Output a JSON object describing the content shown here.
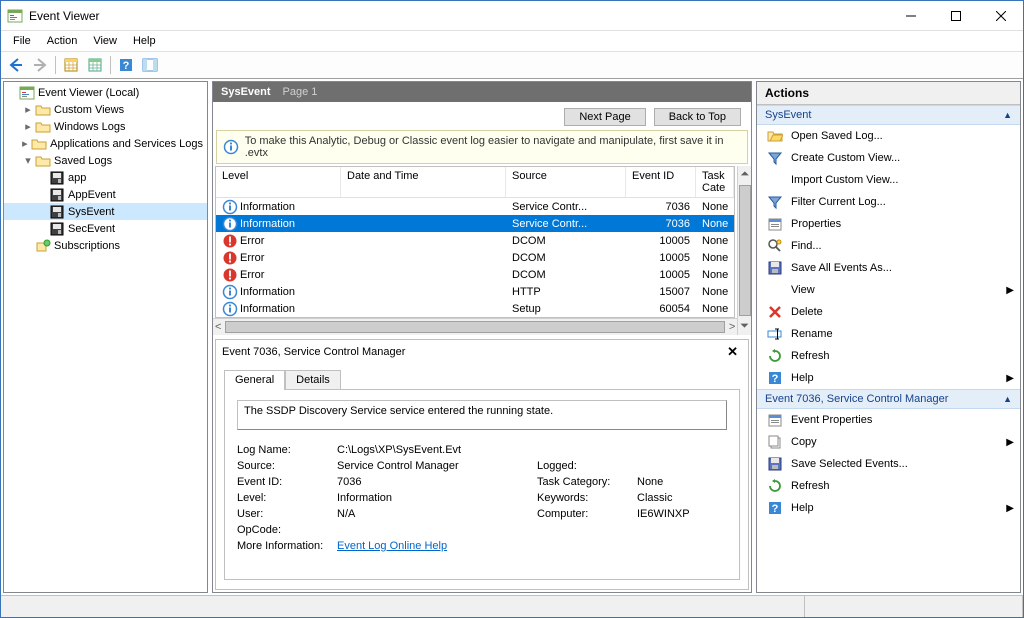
{
  "window": {
    "title": "Event Viewer"
  },
  "menubar": [
    "File",
    "Action",
    "View",
    "Help"
  ],
  "tree": {
    "root": "Event Viewer (Local)",
    "items": [
      {
        "label": "Custom Views",
        "icon": "folder",
        "depth": 1,
        "twisty": ">"
      },
      {
        "label": "Windows Logs",
        "icon": "folder",
        "depth": 1,
        "twisty": ">"
      },
      {
        "label": "Applications and Services Logs",
        "icon": "folder",
        "depth": 1,
        "twisty": ">"
      },
      {
        "label": "Saved Logs",
        "icon": "folder",
        "depth": 1,
        "twisty": "v"
      },
      {
        "label": "app",
        "icon": "disk",
        "depth": 2,
        "twisty": ""
      },
      {
        "label": "AppEvent",
        "icon": "disk",
        "depth": 2,
        "twisty": ""
      },
      {
        "label": "SysEvent",
        "icon": "disk",
        "depth": 2,
        "twisty": "",
        "selected": true
      },
      {
        "label": "SecEvent",
        "icon": "disk",
        "depth": 2,
        "twisty": ""
      },
      {
        "label": "Subscriptions",
        "icon": "subs",
        "depth": 1,
        "twisty": ""
      }
    ]
  },
  "center": {
    "title": "SysEvent",
    "page": "Page 1",
    "nav": {
      "next": "Next Page",
      "top": "Back to Top"
    },
    "infobar": "To make this Analytic, Debug or Classic event log easier to navigate and manipulate, first save it in .evtx",
    "columns": {
      "level": "Level",
      "dt": "Date and Time",
      "src": "Source",
      "eid": "Event ID",
      "tc": "Task Cate"
    },
    "rows": [
      {
        "level": "Information",
        "icon": "info",
        "dt": "",
        "src": "Service Contr...",
        "eid": "7036",
        "tc": "None"
      },
      {
        "level": "Information",
        "icon": "info",
        "dt": "",
        "src": "Service Contr...",
        "eid": "7036",
        "tc": "None",
        "selected": true
      },
      {
        "level": "Error",
        "icon": "error",
        "dt": "",
        "src": "DCOM",
        "eid": "10005",
        "tc": "None"
      },
      {
        "level": "Error",
        "icon": "error",
        "dt": "",
        "src": "DCOM",
        "eid": "10005",
        "tc": "None"
      },
      {
        "level": "Error",
        "icon": "error",
        "dt": "",
        "src": "DCOM",
        "eid": "10005",
        "tc": "None"
      },
      {
        "level": "Information",
        "icon": "info",
        "dt": "",
        "src": "HTTP",
        "eid": "15007",
        "tc": "None"
      },
      {
        "level": "Information",
        "icon": "info",
        "dt": "",
        "src": "Setup",
        "eid": "60054",
        "tc": "None"
      }
    ]
  },
  "detail": {
    "header": "Event 7036, Service Control Manager",
    "tabs": {
      "general": "General",
      "details": "Details"
    },
    "message": "The SSDP Discovery Service service entered the running state.",
    "props": {
      "logname_l": "Log Name:",
      "logname_v": "C:\\Logs\\XP\\SysEvent.Evt",
      "source_l": "Source:",
      "source_v": "Service Control Manager",
      "logged_l": "Logged:",
      "logged_v": "",
      "eventid_l": "Event ID:",
      "eventid_v": "7036",
      "taskcat_l": "Task Category:",
      "taskcat_v": "None",
      "level_l": "Level:",
      "level_v": "Information",
      "keywords_l": "Keywords:",
      "keywords_v": "Classic",
      "user_l": "User:",
      "user_v": "N/A",
      "computer_l": "Computer:",
      "computer_v": "IE6WINXP",
      "opcode_l": "OpCode:",
      "opcode_v": "",
      "moreinfo_l": "More Information:",
      "moreinfo_v": "Event Log Online Help"
    }
  },
  "actions": {
    "header": "Actions",
    "section1": "SysEvent",
    "items1": [
      {
        "label": "Open Saved Log...",
        "icon": "open"
      },
      {
        "label": "Create Custom View...",
        "icon": "filter"
      },
      {
        "label": "Import Custom View...",
        "icon": ""
      },
      {
        "label": "Filter Current Log...",
        "icon": "filter"
      },
      {
        "label": "Properties",
        "icon": "props"
      },
      {
        "label": "Find...",
        "icon": "find"
      },
      {
        "label": "Save All Events As...",
        "icon": "save"
      },
      {
        "label": "View",
        "icon": "",
        "submenu": true
      },
      {
        "label": "Delete",
        "icon": "delete"
      },
      {
        "label": "Rename",
        "icon": "rename"
      },
      {
        "label": "Refresh",
        "icon": "refresh"
      },
      {
        "label": "Help",
        "icon": "help",
        "submenu": true
      }
    ],
    "section2": "Event 7036, Service Control Manager",
    "items2": [
      {
        "label": "Event Properties",
        "icon": "props"
      },
      {
        "label": "Copy",
        "icon": "copy",
        "submenu": true
      },
      {
        "label": "Save Selected Events...",
        "icon": "save"
      },
      {
        "label": "Refresh",
        "icon": "refresh"
      },
      {
        "label": "Help",
        "icon": "help",
        "submenu": true
      }
    ]
  }
}
